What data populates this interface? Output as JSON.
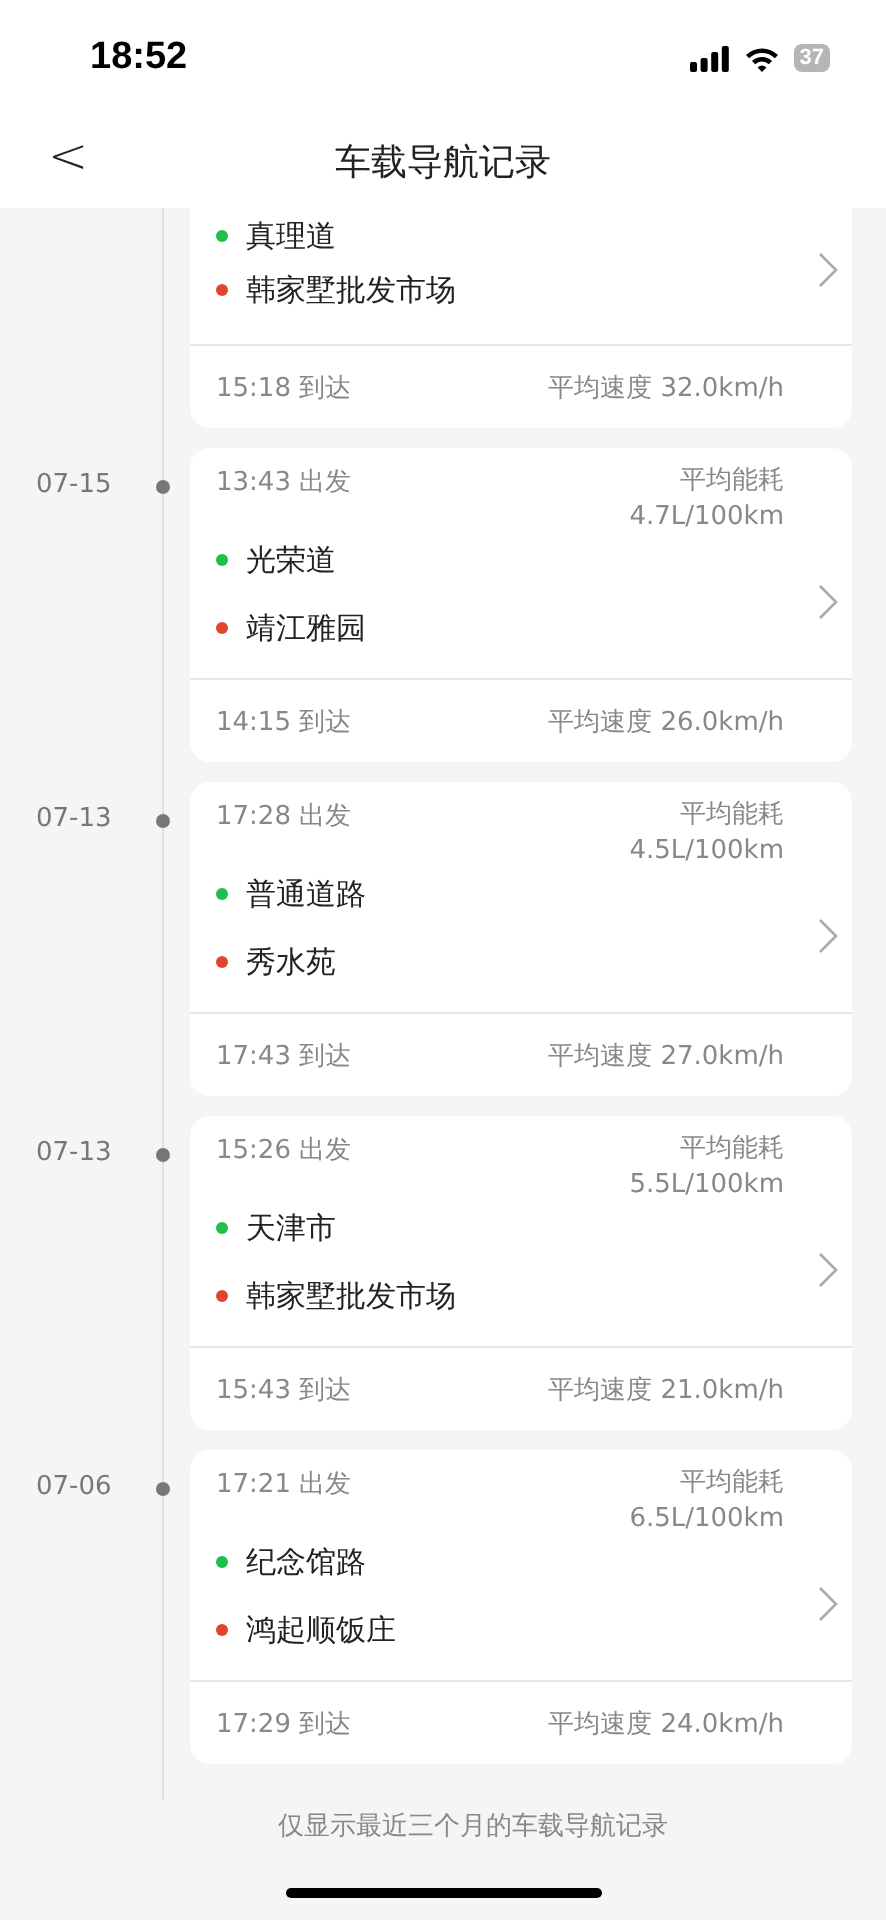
{
  "status_bar": {
    "time": "18:52",
    "battery": "37"
  },
  "nav": {
    "back": "<",
    "title": "车载导航记录"
  },
  "trips": [
    {
      "kind": "partial",
      "origin": "真理道",
      "destination": "韩家墅批发市场",
      "arrive": "15:18 到达",
      "speed": "平均速度 32.0km/h"
    },
    {
      "kind": "full",
      "date": "07-15",
      "depart": "13:43 出发",
      "energy_label": "平均能耗",
      "energy": "4.7L/100km",
      "origin": "光荣道",
      "destination": "靖江雅园",
      "arrive": "14:15 到达",
      "speed": "平均速度 26.0km/h"
    },
    {
      "kind": "full",
      "date": "07-13",
      "depart": "17:28 出发",
      "energy_label": "平均能耗",
      "energy": "4.5L/100km",
      "origin": "普通道路",
      "destination": "秀水苑",
      "arrive": "17:43 到达",
      "speed": "平均速度 27.0km/h"
    },
    {
      "kind": "full",
      "date": "07-13",
      "depart": "15:26 出发",
      "energy_label": "平均能耗",
      "energy": "5.5L/100km",
      "origin": "天津市",
      "destination": "韩家墅批发市场",
      "arrive": "15:43 到达",
      "speed": "平均速度 21.0km/h"
    },
    {
      "kind": "full",
      "date": "07-06",
      "depart": "17:21 出发",
      "energy_label": "平均能耗",
      "energy": "6.5L/100km",
      "origin": "纪念馆路",
      "destination": "鸿起顺饭庄",
      "arrive": "17:29 到达",
      "speed": "平均速度 24.0km/h"
    }
  ],
  "footer_note": "仅显示最近三个月的车载导航记录"
}
